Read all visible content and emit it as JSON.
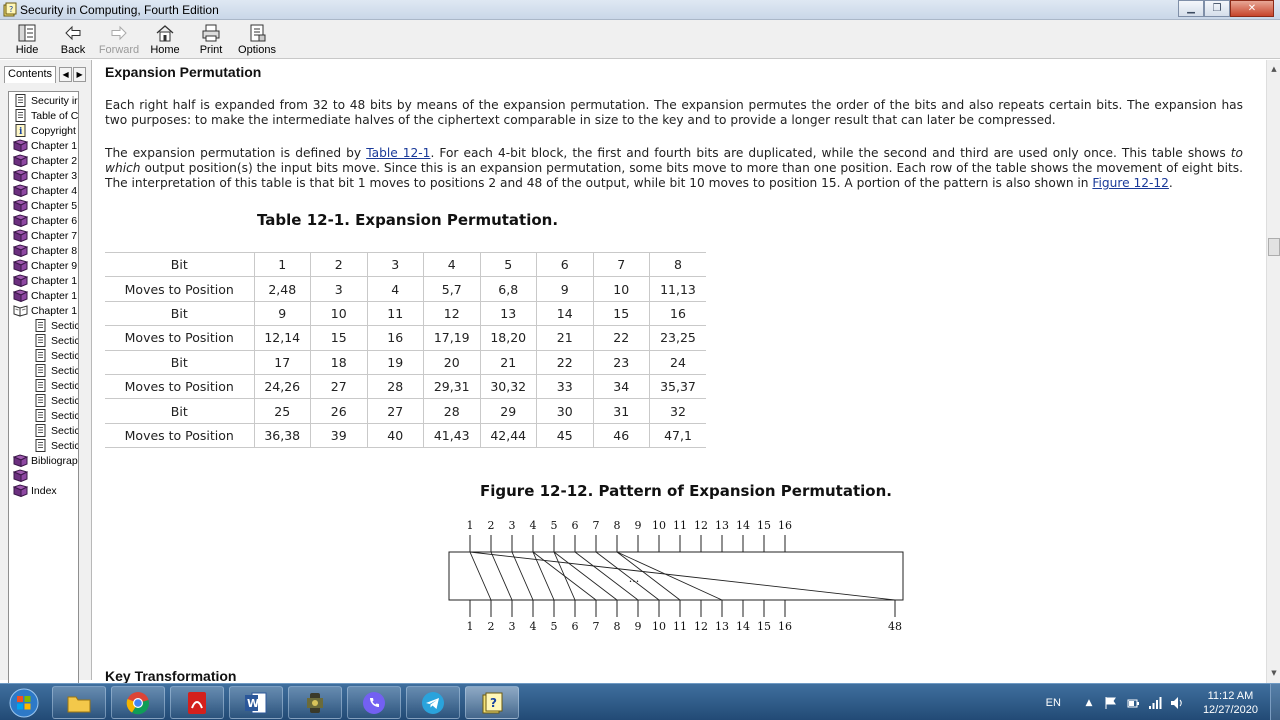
{
  "window": {
    "title": "Security in Computing, Fourth Edition"
  },
  "toolbar": {
    "buttons": [
      {
        "label": "Hide",
        "enabled": true
      },
      {
        "label": "Back",
        "enabled": true
      },
      {
        "label": "Forward",
        "enabled": false
      },
      {
        "label": "Home",
        "enabled": true
      },
      {
        "label": "Print",
        "enabled": true
      },
      {
        "label": "Options",
        "enabled": true
      }
    ]
  },
  "nav": {
    "tab_label": "Contents",
    "tree": [
      {
        "label": "Security ir",
        "icon": "page-icon",
        "indent": 0
      },
      {
        "label": "Table of C",
        "icon": "page-icon",
        "indent": 0
      },
      {
        "label": "Copyright",
        "icon": "info-icon",
        "indent": 0
      },
      {
        "label": "Chapter 1",
        "icon": "book-icon",
        "indent": 0
      },
      {
        "label": "Chapter 2",
        "icon": "book-icon",
        "indent": 0
      },
      {
        "label": "Chapter 3",
        "icon": "book-icon",
        "indent": 0
      },
      {
        "label": "Chapter 4",
        "icon": "book-icon",
        "indent": 0
      },
      {
        "label": "Chapter 5",
        "icon": "book-icon",
        "indent": 0
      },
      {
        "label": "Chapter 6",
        "icon": "book-icon",
        "indent": 0
      },
      {
        "label": "Chapter 7",
        "icon": "book-icon",
        "indent": 0
      },
      {
        "label": "Chapter 8",
        "icon": "book-icon",
        "indent": 0
      },
      {
        "label": "Chapter 9",
        "icon": "book-icon",
        "indent": 0
      },
      {
        "label": "Chapter 1",
        "icon": "book-icon",
        "indent": 0
      },
      {
        "label": "Chapter 1",
        "icon": "book-icon",
        "indent": 0
      },
      {
        "label": "Chapter 1",
        "icon": "open-book-icon",
        "indent": 0
      },
      {
        "label": "Sectic",
        "icon": "page-icon",
        "indent": 1
      },
      {
        "label": "Sectic",
        "icon": "page-icon",
        "indent": 1
      },
      {
        "label": "Sectic",
        "icon": "page-icon",
        "indent": 1
      },
      {
        "label": "Sectic",
        "icon": "page-icon",
        "indent": 1
      },
      {
        "label": "Sectic",
        "icon": "page-icon",
        "indent": 1
      },
      {
        "label": "Sectic",
        "icon": "page-icon",
        "indent": 1
      },
      {
        "label": "Sectic",
        "icon": "page-icon",
        "indent": 1
      },
      {
        "label": "Sectic",
        "icon": "page-icon",
        "indent": 1
      },
      {
        "label": "Sectic",
        "icon": "page-icon",
        "indent": 1
      },
      {
        "label": "Bibliograp",
        "icon": "book-icon",
        "indent": 0
      },
      {
        "label": "",
        "icon": "book-icon",
        "indent": 0
      },
      {
        "label": "Index",
        "icon": "book-icon",
        "indent": 0
      }
    ]
  },
  "content": {
    "heading": "Expansion Permutation",
    "p1": "Each right half is expanded from 32 to 48 bits by means of the expansion permutation. The expansion permutes the order of the bits and also repeats certain bits. The expansion has two purposes: to make the intermediate halves of the ciphertext comparable in size to the key and to provide a longer result that can later be compressed.",
    "p2": {
      "t1": "The expansion permutation is defined by ",
      "link1": "Table 12-1",
      "t2": ". For each 4-bit block, the first and fourth bits are duplicated, while the second and third are used only once. This table shows ",
      "em": "to which",
      "t3": " output position(s) the input bits move. Since this is an expansion permutation, some bits move to more than one position. Each row of the table shows the movement of eight bits. The interpretation of this table is that bit 1 moves to positions 2 and 48 of the output, while bit 10 moves to position 15. A portion of the pattern is also shown in ",
      "link2": "Figure 12-12",
      "t4": "."
    },
    "table_caption": "Table 12-1. Expansion Permutation.",
    "table_rows": [
      [
        "Bit",
        "1",
        "2",
        "3",
        "4",
        "5",
        "6",
        "7",
        "8"
      ],
      [
        "Moves to Position",
        "2,48",
        "3",
        "4",
        "5,7",
        "6,8",
        "9",
        "10",
        "11,13"
      ],
      [
        "Bit",
        "9",
        "10",
        "11",
        "12",
        "13",
        "14",
        "15",
        "16"
      ],
      [
        "Moves to Position",
        "12,14",
        "15",
        "16",
        "17,19",
        "18,20",
        "21",
        "22",
        "23,25"
      ],
      [
        "Bit",
        "17",
        "18",
        "19",
        "20",
        "21",
        "22",
        "23",
        "24"
      ],
      [
        "Moves to Position",
        "24,26",
        "27",
        "28",
        "29,31",
        "30,32",
        "33",
        "34",
        "35,37"
      ],
      [
        "Bit",
        "25",
        "26",
        "27",
        "28",
        "29",
        "30",
        "31",
        "32"
      ],
      [
        "Moves to Position",
        "36,38",
        "39",
        "40",
        "41,43",
        "42,44",
        "45",
        "46",
        "47,1"
      ]
    ],
    "figure_caption": "Figure 12-12. Pattern of Expansion Permutation.",
    "figure": {
      "top_labels": [
        "1",
        "2",
        "3",
        "4",
        "5",
        "6",
        "7",
        "8",
        "9",
        "10",
        "11",
        "12",
        "13",
        "14",
        "15",
        "16"
      ],
      "bottom_labels": [
        "1",
        "2",
        "3",
        "4",
        "5",
        "6",
        "7",
        "8",
        "9",
        "10",
        "11",
        "12",
        "13",
        "14",
        "15",
        "16"
      ],
      "last_label": "48",
      "ellipsis": "..."
    },
    "next_heading": "Key Transformation"
  },
  "taskbar": {
    "apps": [
      "folder-icon",
      "chrome-icon",
      "pdf-icon",
      "word-icon",
      "media-icon",
      "viber-icon",
      "telegram-icon",
      "help-icon"
    ],
    "lang": "EN",
    "time": "11:12 AM",
    "date": "12/27/2020"
  }
}
